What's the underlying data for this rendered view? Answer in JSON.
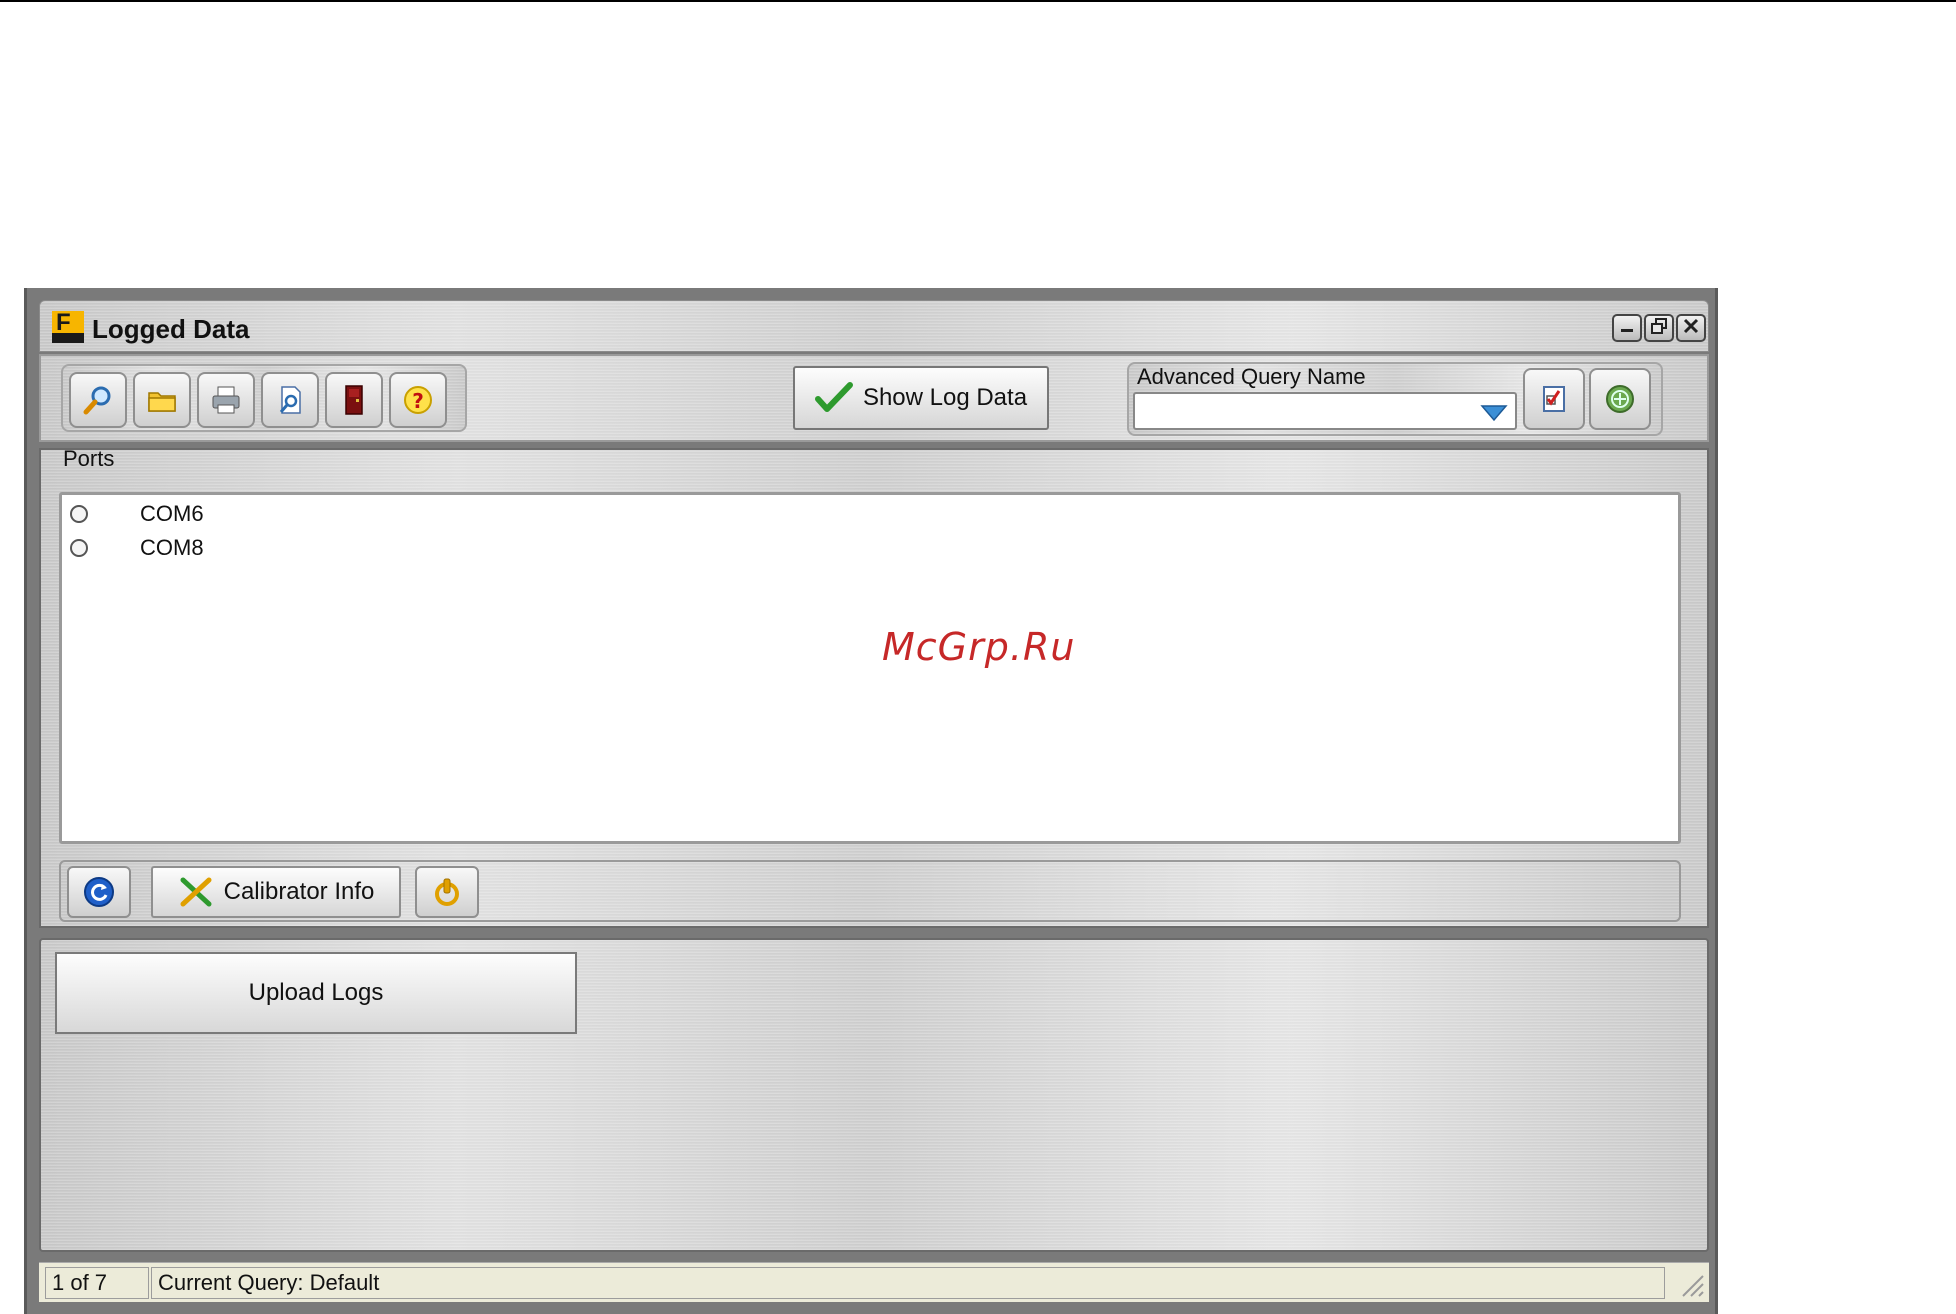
{
  "window": {
    "title": "Logged Data",
    "app_logo_letter": "F",
    "controls": [
      "minimize",
      "restore",
      "close"
    ]
  },
  "toolbar": {
    "icons": [
      "search-icon",
      "folder-icon",
      "printer-icon",
      "print-preview-icon",
      "exit-door-icon",
      "help-icon"
    ],
    "show_log_label": "Show Log Data",
    "advanced_query": {
      "label": "Advanced Query Name",
      "value": "",
      "edit_icon": "checklist-edit-icon",
      "run_icon": "globe-run-icon"
    }
  },
  "ports": {
    "legend": "Ports",
    "items": [
      {
        "label": "COM6",
        "selected": false
      },
      {
        "label": "COM8",
        "selected": false
      }
    ],
    "refresh_icon": "refresh-icon",
    "calibrator_label": "Calibrator Info",
    "power_icon": "power-icon"
  },
  "watermark": "McGrp.Ru",
  "upload_label": "Upload Logs",
  "status": {
    "page": "1 of 7",
    "query": "Current Query: Default"
  }
}
